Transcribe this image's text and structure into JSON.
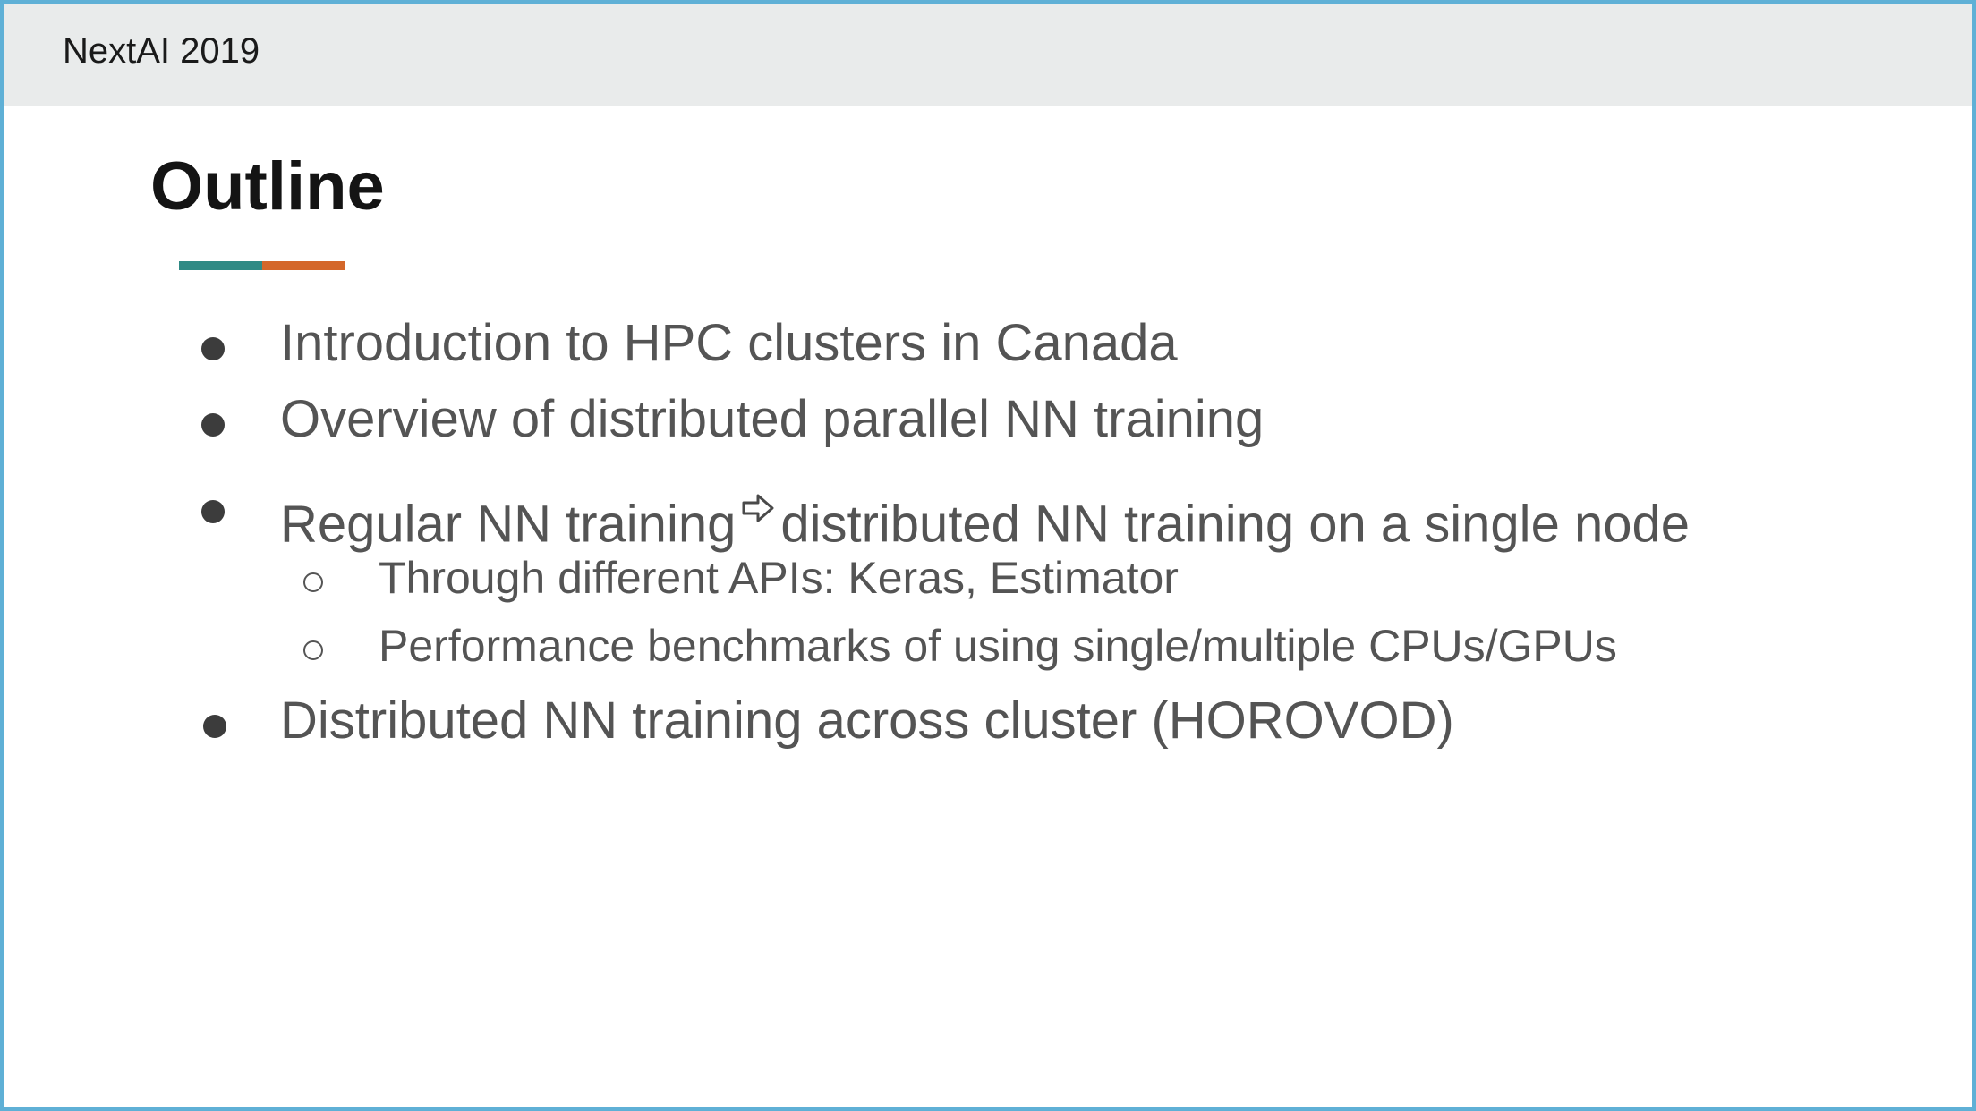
{
  "header": {
    "title": "NextAI 2019"
  },
  "slide": {
    "title": "Outline",
    "underline_colors": [
      "#2f8a85",
      "#d4672a"
    ],
    "bullets": [
      {
        "text": "Introduction to HPC clusters in Canada"
      },
      {
        "text": "Overview of distributed parallel NN training"
      },
      {
        "text_before": "Regular NN training",
        "icon": "right-arrow-icon",
        "text_after": "distributed NN training on a single node",
        "sub": [
          {
            "text": "Through different APIs: Keras, Estimator"
          },
          {
            "text": "Performance benchmarks of using single/multiple CPUs/GPUs"
          }
        ]
      },
      {
        "text": "Distributed NN training across cluster (HOROVOD)"
      }
    ]
  },
  "colors": {
    "frame_border": "#5fb0d6",
    "header_background": "#e9ebeb",
    "body_text": "#545454"
  }
}
